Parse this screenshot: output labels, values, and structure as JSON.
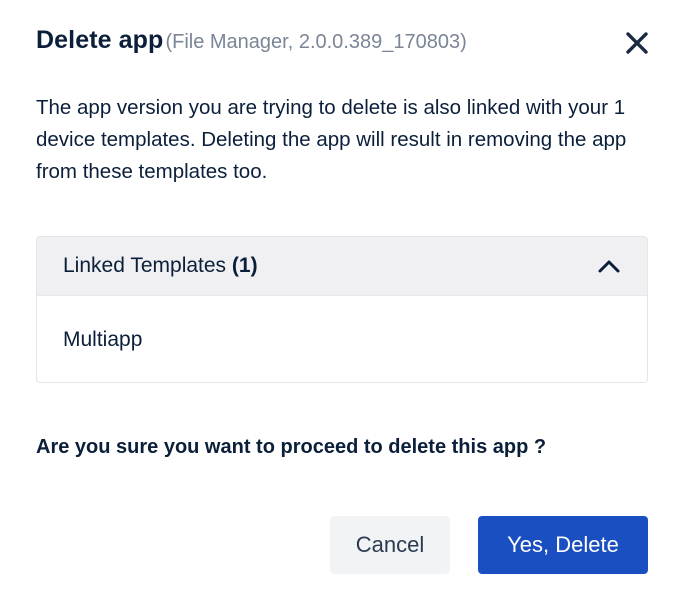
{
  "dialog": {
    "title": "Delete app",
    "subtitle": "(File Manager, 2.0.0.389_170803)",
    "close_icon": "close-icon",
    "message": "The app version you are trying to delete is also linked with your 1 device templates. Deleting the app will result in removing the app from these templates too.",
    "linked_templates": {
      "label": "Linked Templates",
      "count": "(1)",
      "expanded": true,
      "toggle_icon": "chevron-up-icon",
      "items": [
        "Multiapp"
      ]
    },
    "confirm_question": "Are you sure you want to proceed to delete this app ?",
    "cancel_label": "Cancel",
    "delete_label": "Yes, Delete"
  },
  "colors": {
    "primary": "#1a4fc2",
    "text": "#0b1f3a",
    "muted": "#7a8596",
    "accordion_header_bg": "#f0f0f2",
    "cancel_bg": "#f2f3f5"
  }
}
